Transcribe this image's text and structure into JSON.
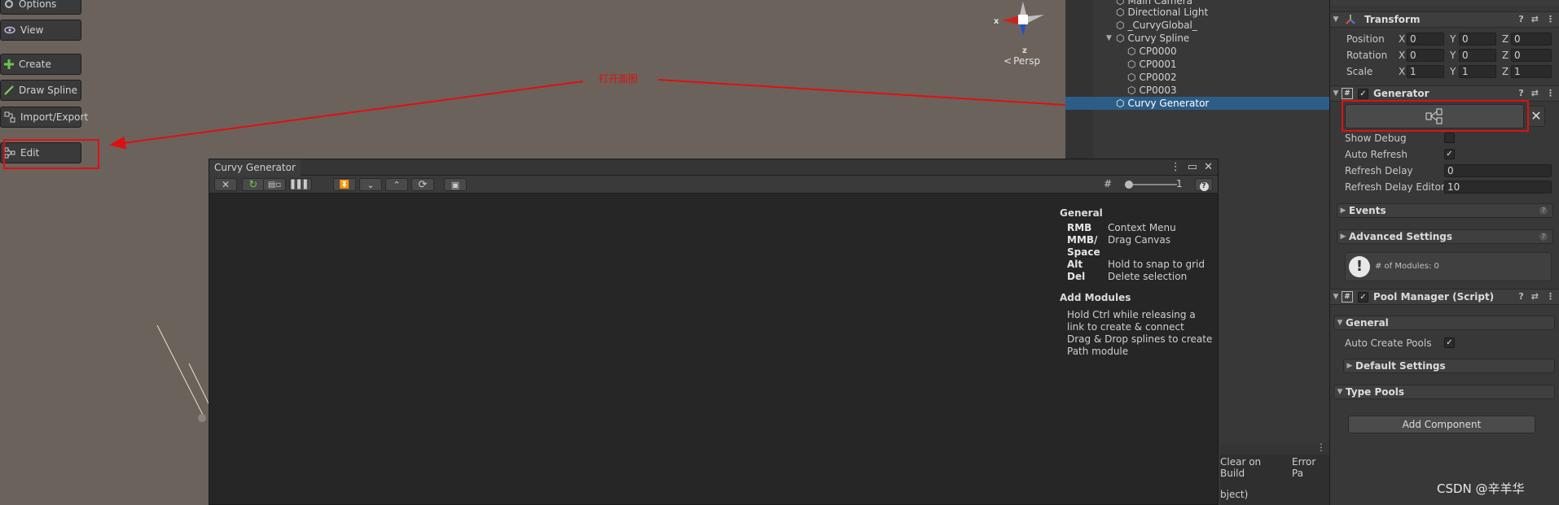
{
  "scene_toolbar": {
    "options": "Options",
    "view": "View",
    "create": "Create",
    "draw_spline": "Draw Spline",
    "import_export": "Import/Export",
    "edit": "Edit"
  },
  "annotation": {
    "label": "打开面图"
  },
  "gizmo": {
    "x": "x",
    "z": "z",
    "persp": "Persp"
  },
  "hierarchy": {
    "items": [
      {
        "label": "Main Camera"
      },
      {
        "label": "Directional Light"
      },
      {
        "label": "_CurvyGlobal_"
      },
      {
        "label": "Curvy Spline"
      },
      {
        "label": "CP0000"
      },
      {
        "label": "CP0001"
      },
      {
        "label": "CP0002"
      },
      {
        "label": "CP0003"
      },
      {
        "label": "Curvy Generator"
      }
    ]
  },
  "console": {
    "clear_on_build": "Clear on Build",
    "error_pause": "Error Pa",
    "bottom_text": "bject)"
  },
  "inspector": {
    "transform": {
      "title": "Transform",
      "position_label": "Position",
      "rotation_label": "Rotation",
      "scale_label": "Scale",
      "position": [
        "0",
        "0",
        "0"
      ],
      "rotation": [
        "0",
        "0",
        "0"
      ],
      "scale": [
        "1",
        "1",
        "1"
      ],
      "axes": [
        "X",
        "Y",
        "Z"
      ]
    },
    "generator": {
      "title": "Generator",
      "show_debug": "Show Debug",
      "auto_refresh": "Auto Refresh",
      "refresh_delay": "Refresh Delay",
      "refresh_delay_value": "0",
      "refresh_delay_editor": "Refresh Delay Editor",
      "refresh_delay_editor_value": "10",
      "events": "Events",
      "advanced_settings": "Advanced Settings",
      "modules_info": "# of Modules: 0"
    },
    "pool_manager": {
      "title": "Pool Manager (Script)",
      "general": "General",
      "auto_create_pools": "Auto Create Pools",
      "default_settings": "Default Settings",
      "type_pools": "Type Pools"
    },
    "add_component": "Add Component"
  },
  "curvy_generator": {
    "title": "Curvy Generator",
    "zoom_value": "1",
    "help": {
      "general_title": "General",
      "rows": [
        {
          "key": "RMB",
          "desc": "Context Menu"
        },
        {
          "key": "MMB/",
          "desc": "Drag Canvas"
        },
        {
          "key": "Space",
          "desc": ""
        },
        {
          "key": "Alt",
          "desc": "Hold to snap to grid"
        },
        {
          "key": "Del",
          "desc": "Delete selection"
        }
      ],
      "add_modules_title": "Add Modules",
      "add_modules_lines": [
        "Hold Ctrl while releasing a",
        "link to create & connect",
        "Drag & Drop splines to create",
        "Path module"
      ]
    }
  },
  "watermark": "CSDN @辛羊华"
}
